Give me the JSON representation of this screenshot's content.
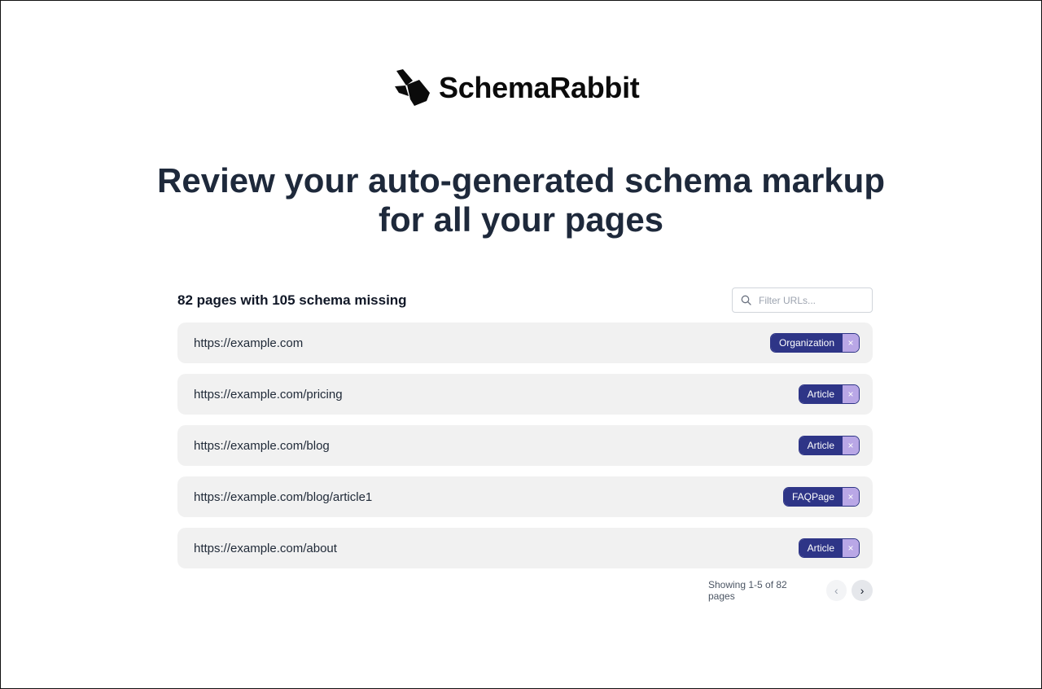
{
  "brand": {
    "name": "SchemaRabbit",
    "logo_icon": "rabbit-shapes-icon"
  },
  "headline": {
    "line1": "Review your auto-generated schema markup",
    "line2": "for all your pages"
  },
  "summary": "82 pages with 105 schema missing",
  "filter": {
    "placeholder": "Filter URLs...",
    "value": "",
    "icon": "search-icon"
  },
  "rows": [
    {
      "url": "https://example.com",
      "tag": "Organization"
    },
    {
      "url": "https://example.com/pricing",
      "tag": "Article"
    },
    {
      "url": "https://example.com/blog",
      "tag": "Article"
    },
    {
      "url": "https://example.com/blog/article1",
      "tag": "FAQPage"
    },
    {
      "url": "https://example.com/about",
      "tag": "Article"
    }
  ],
  "tag_remove_glyph": "×",
  "pagination": {
    "text": "Showing 1-5 of 82 pages",
    "prev_glyph": "‹",
    "next_glyph": "›"
  },
  "colors": {
    "tag_bg": "#2e3587",
    "tag_remove_bg": "#b9a7e6",
    "row_bg": "#f1f1f1",
    "headline": "#1e293b"
  }
}
